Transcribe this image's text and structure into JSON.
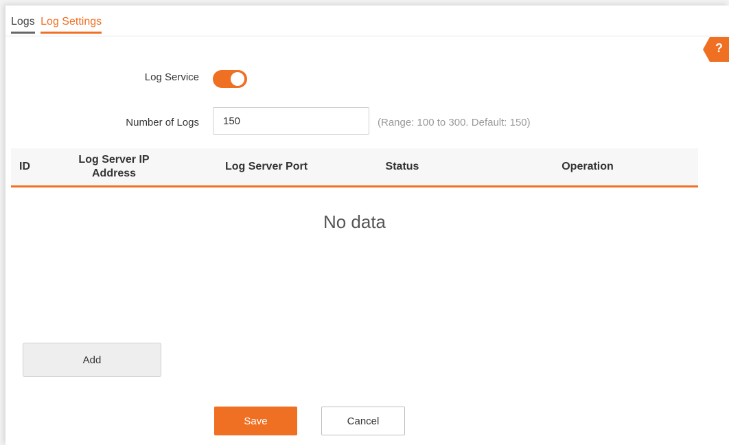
{
  "tabs": [
    {
      "label": "Logs"
    },
    {
      "label": "Log Settings"
    }
  ],
  "help": {
    "label": "?"
  },
  "form": {
    "log_service": {
      "label": "Log Service",
      "enabled": true
    },
    "number_of_logs": {
      "label": "Number of Logs",
      "value": "150",
      "hint": "(Range: 100 to 300. Default: 150)"
    }
  },
  "table": {
    "columns": [
      "ID",
      "Log Server IP Address",
      "Log Server Port",
      "Status",
      "Operation"
    ],
    "empty_text": "No data"
  },
  "buttons": {
    "add": "Add",
    "save": "Save",
    "cancel": "Cancel"
  },
  "colors": {
    "accent": "#f07023"
  }
}
